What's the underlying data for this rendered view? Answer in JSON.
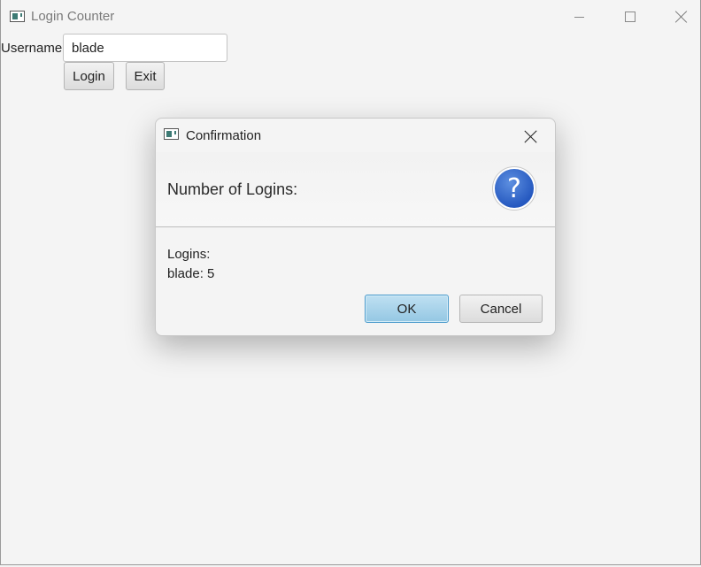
{
  "window": {
    "title": "Login Counter",
    "controls": {
      "minimize": "minimize-icon",
      "maximize": "maximize-icon",
      "close": "close-icon"
    }
  },
  "form": {
    "username_label": "Username:",
    "username_value": "blade",
    "login_label": "Login",
    "exit_label": "Exit"
  },
  "dialog": {
    "title": "Confirmation",
    "header": "Number of Logins:",
    "icon": "question-icon",
    "icon_glyph": "?",
    "content_lines": [
      "Logins:",
      "blade: 5"
    ],
    "ok_label": "OK",
    "cancel_label": "Cancel"
  },
  "colors": {
    "default_button": "#9cc9e4",
    "question_icon": "#2f63c8"
  }
}
